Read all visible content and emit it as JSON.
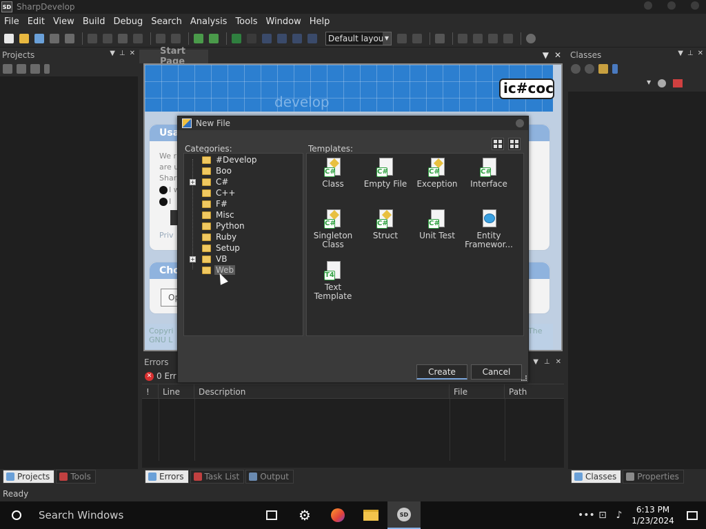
{
  "window": {
    "title": "SharpDevelop",
    "icon_text": "SD"
  },
  "menu": [
    "File",
    "Edit",
    "View",
    "Build",
    "Debug",
    "Search",
    "Analysis",
    "Tools",
    "Window",
    "Help"
  ],
  "toolbar": {
    "layout_value": "Default layout"
  },
  "projects_panel": {
    "title": "Projects"
  },
  "classes_panel": {
    "title": "Classes"
  },
  "document": {
    "tab_label": "Start Page",
    "banner_text": "develop",
    "logo_text": "ic#coc"
  },
  "start_page": {
    "card1_title": "Usa",
    "card2_title": "Cho",
    "card1_lines": [
      "We r",
      "are u",
      "Shar"
    ],
    "card1_option1": "I w",
    "card1_option2": "I",
    "card1_link": "Priv",
    "card2_btn": "Op",
    "footer_left_1": "Copyri",
    "footer_left_2": "GNU L",
    "footer_right": "The"
  },
  "errors_pane": {
    "title": "Errors",
    "count_text": "0 Err",
    "columns": [
      "!",
      "Line",
      "Description",
      "File",
      "Path"
    ]
  },
  "left_bottom_tabs": [
    "Projects",
    "Tools"
  ],
  "center_bottom_tabs": [
    "Errors",
    "Task List",
    "Output"
  ],
  "right_bottom_tabs": [
    "Classes",
    "Properties"
  ],
  "status": {
    "text": "Ready"
  },
  "taskbar": {
    "search_text": "Search Windows",
    "time": "6:13 PM",
    "date": "1/23/2024"
  },
  "dialog": {
    "title": "New File",
    "categories_label": "Categories:",
    "templates_label": "Templates:",
    "categories": [
      {
        "label": "#Develop",
        "expandable": false
      },
      {
        "label": "Boo",
        "expandable": false
      },
      {
        "label": "C#",
        "expandable": true
      },
      {
        "label": "C++",
        "expandable": false
      },
      {
        "label": "F#",
        "expandable": false
      },
      {
        "label": "Misc",
        "expandable": false
      },
      {
        "label": "Python",
        "expandable": false
      },
      {
        "label": "Ruby",
        "expandable": false
      },
      {
        "label": "Setup",
        "expandable": false
      },
      {
        "label": "VB",
        "expandable": true
      },
      {
        "label": "Web",
        "expandable": false,
        "selected": true
      }
    ],
    "templates": [
      {
        "label": "Class",
        "icon": "csharp-class-icon"
      },
      {
        "label": "Empty File",
        "icon": "csharp-empty-file-icon"
      },
      {
        "label": "Exception",
        "icon": "csharp-exception-icon"
      },
      {
        "label": "Interface",
        "icon": "csharp-interface-icon"
      },
      {
        "label": "Singleton Class",
        "icon": "csharp-singleton-icon"
      },
      {
        "label": "Struct",
        "icon": "csharp-struct-icon"
      },
      {
        "label": "Unit Test",
        "icon": "csharp-unit-test-icon"
      },
      {
        "label": "Entity Framewor...",
        "icon": "entity-framework-icon"
      },
      {
        "label": "Text Template",
        "icon": "t4-template-icon"
      }
    ],
    "create_label": "Create",
    "cancel_label": "Cancel"
  }
}
